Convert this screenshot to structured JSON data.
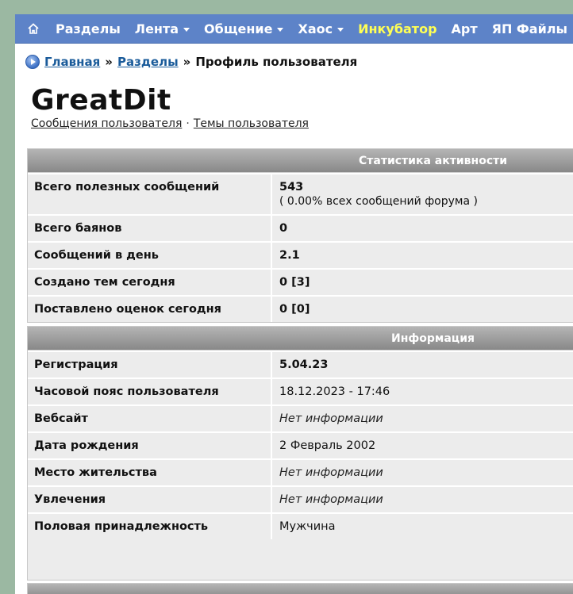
{
  "nav": {
    "items": [
      {
        "label": "Разделы",
        "dropdown": false
      },
      {
        "label": "Лента",
        "dropdown": true
      },
      {
        "label": "Общение",
        "dropdown": true
      },
      {
        "label": "Хаос",
        "dropdown": true
      },
      {
        "label": "Инкубатор",
        "dropdown": false,
        "highlight": true
      },
      {
        "label": "Арт",
        "dropdown": false
      },
      {
        "label": "ЯП Файлы",
        "dropdown": false
      }
    ]
  },
  "breadcrumb": {
    "home": "Главная",
    "sep": "»",
    "sections": "Разделы",
    "current": "Профиль пользователя"
  },
  "profile": {
    "username": "GreatDit",
    "link_posts": "Сообщения пользователя",
    "link_dot": "·",
    "link_topics": "Темы пользователя"
  },
  "stats": {
    "header": "Статистика активности",
    "rows": [
      {
        "label": "Всего полезных сообщений",
        "value": "543",
        "sub": "( 0.00% всех сообщений форума )"
      },
      {
        "label": "Всего баянов",
        "value": "0"
      },
      {
        "label": "Сообщений в день",
        "value": "2.1"
      },
      {
        "label": "Создано тем сегодня",
        "value": "0 [3]"
      },
      {
        "label": "Поставлено оценок сегодня",
        "value": "0 [0]"
      }
    ]
  },
  "info": {
    "header": "Информация",
    "rows": [
      {
        "label": "Регистрация",
        "value": "5.04.23",
        "style": "b"
      },
      {
        "label": "Часовой пояс пользователя",
        "value": "18.12.2023 - 17:46",
        "style": ""
      },
      {
        "label": "Вебсайт",
        "value": "Нет информации",
        "style": "i"
      },
      {
        "label": "Дата рождения",
        "value": "2 Февраль 2002",
        "style": ""
      },
      {
        "label": "Место жительства",
        "value": "Нет информации",
        "style": "i"
      },
      {
        "label": "Увлечения",
        "value": "Нет информации",
        "style": "i"
      },
      {
        "label": "Половая принадлежность",
        "value": "Мужчина",
        "style": ""
      }
    ]
  }
}
